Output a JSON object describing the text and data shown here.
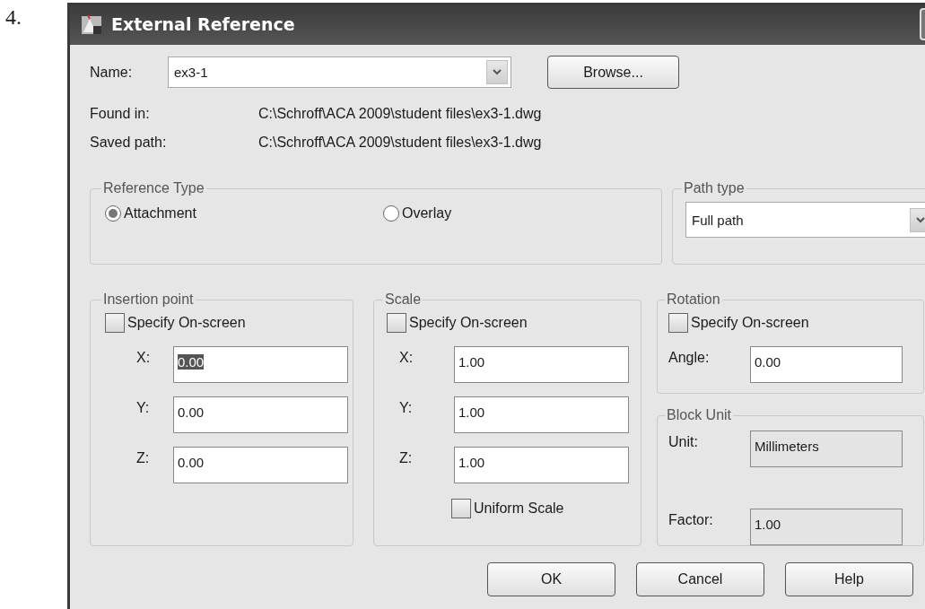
{
  "step_number": "4.",
  "window": {
    "title": "External Reference"
  },
  "name_row": {
    "label": "Name:",
    "value": "ex3-1",
    "browse_button": "Browse..."
  },
  "found_in": {
    "label": "Found in:",
    "value": "C:\\Schroff\\ACA 2009\\student files\\ex3-1.dwg"
  },
  "saved_path": {
    "label": "Saved path:",
    "value": "C:\\Schroff\\ACA 2009\\student files\\ex3-1.dwg"
  },
  "reference_type": {
    "title": "Reference Type",
    "options": [
      {
        "label": "Attachment",
        "selected": true
      },
      {
        "label": "Overlay",
        "selected": false
      }
    ]
  },
  "path_type": {
    "title": "Path type",
    "value": "Full path"
  },
  "insertion_point": {
    "title": "Insertion point",
    "specify_on_screen": {
      "label": "Specify On-screen",
      "checked": false
    },
    "fields": [
      {
        "label": "X:",
        "value": "0.00",
        "text_selected": true
      },
      {
        "label": "Y:",
        "value": "0.00",
        "text_selected": false
      },
      {
        "label": "Z:",
        "value": "0.00",
        "text_selected": false
      }
    ]
  },
  "scale": {
    "title": "Scale",
    "specify_on_screen": {
      "label": "Specify On-screen",
      "checked": false
    },
    "fields": [
      {
        "label": "X:",
        "value": "1.00",
        "text_selected": false
      },
      {
        "label": "Y:",
        "value": "1.00",
        "text_selected": false
      },
      {
        "label": "Z:",
        "value": "1.00",
        "text_selected": false
      }
    ],
    "uniform_scale": {
      "label": "Uniform Scale",
      "checked": false
    }
  },
  "rotation": {
    "title": "Rotation",
    "specify_on_screen": {
      "label": "Specify On-screen",
      "checked": false
    },
    "angle": {
      "label": "Angle:",
      "value": "0.00",
      "read_only": false
    }
  },
  "block_unit": {
    "title": "Block Unit",
    "fields": [
      {
        "label": "Unit:",
        "value": "Millimeters",
        "read_only": true
      },
      {
        "label": "Factor:",
        "value": "1.00",
        "read_only": true
      }
    ]
  },
  "buttons": [
    "OK",
    "Cancel",
    "Help"
  ]
}
